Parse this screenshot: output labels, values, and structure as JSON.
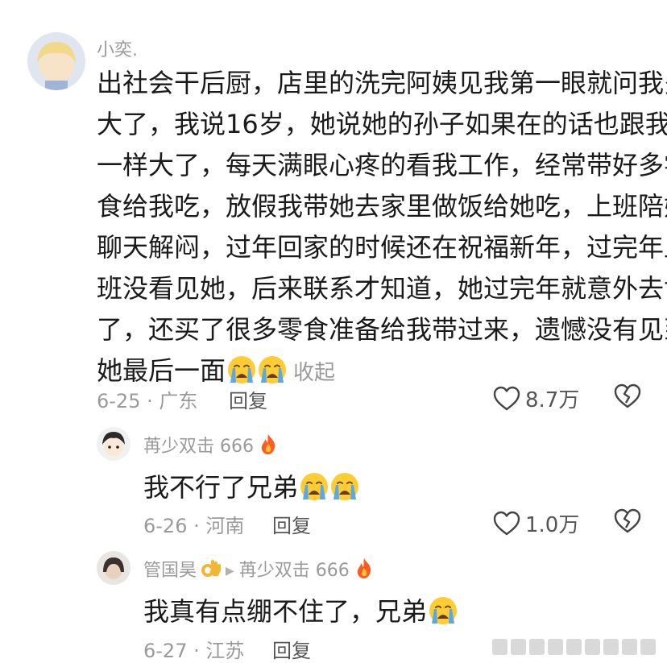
{
  "main_comment": {
    "username": "小奕.",
    "lines": [
      "出社会干后厨，店里的洗完阿姨见我第一眼就问我多",
      "大了，我说16岁，她说她的孙子如果在的话也跟我",
      "一样大了，每天满眼心疼的看我工作，经常带好多零",
      "食给我吃，放假我带她去家里做饭给她吃，上班陪她",
      "聊天解闷，过年回家的时候还在祝福新年，过完年上",
      "班没看见她，后来联系才知道，她过完年就意外去世",
      "了，还买了很多零食准备给我带过来，遗憾没有见到",
      "她最后一面"
    ],
    "collapse_label": "收起",
    "date_location": "6-25 · 广东",
    "reply_label": "回复",
    "likes": "8.7万"
  },
  "replies": [
    {
      "username": "苒少双击 666",
      "text": "我不行了兄弟",
      "date_location": "6-26 · 河南",
      "reply_label": "回复",
      "likes": "1.0万"
    },
    {
      "username": "管国昊",
      "reply_to": "苒少双击 666",
      "text": "我真有点绷不住了，兄弟",
      "date_location": "6-27 · 江苏",
      "reply_label": "回复"
    }
  ],
  "icons": {
    "crying": "loudly-crying-face-emoji",
    "fire": "fire-emoji",
    "ok_hand": "ok-hand-emoji",
    "heart": "heart-outline-icon",
    "broken_heart": "broken-heart-outline-icon"
  },
  "colors": {
    "text": "#1a1a1a",
    "secondary": "#9a9a9a",
    "emoji_yellow": "#ffcc33",
    "tear_blue": "#5aa9e6"
  }
}
